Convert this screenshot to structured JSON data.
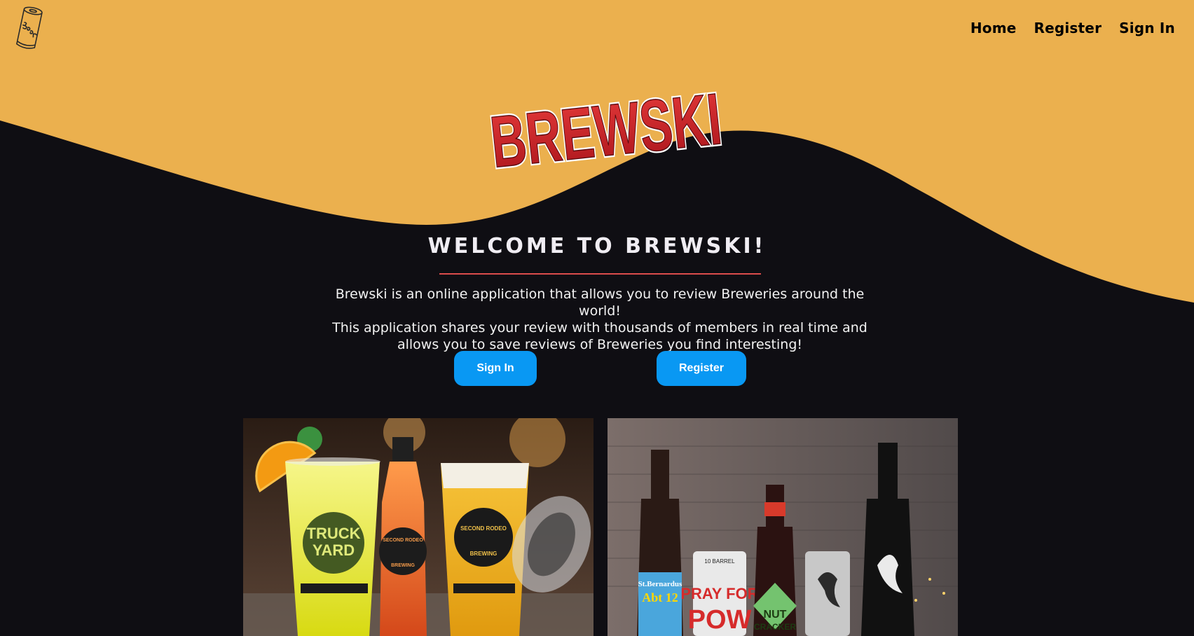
{
  "nav": {
    "logo_icon": "beer-can-icon",
    "links": [
      {
        "label": "Home"
      },
      {
        "label": "Register"
      },
      {
        "label": "Sign In"
      }
    ]
  },
  "hero": {
    "logo_text": "BREWSKI",
    "heading": "WELCOME TO BREWSKI!",
    "intro_lines": [
      "Brewski is an online application that allows you to review Breweries around the world!",
      "This application shares your review with thousands of members in real time and",
      "allows you to save reviews of Breweries you find interesting!"
    ],
    "buttons": {
      "signin": "Sign In",
      "register": "Register"
    }
  },
  "gallery": {
    "left": {
      "truck_yard": [
        "TRUCK",
        "YARD"
      ],
      "rodeo_bottle": [
        "SECOND RODEO",
        "BREWING"
      ],
      "rodeo_cup": [
        "SECOND RODEO",
        "BREWING"
      ]
    },
    "right": {
      "bernardus": [
        "St.Bernardus",
        "Abt 12"
      ],
      "can_brand": "10 BARREL",
      "can_text": [
        "PRAY FOR",
        "POW"
      ],
      "nutcracker": [
        "NUT",
        "CRACKER"
      ]
    }
  },
  "colors": {
    "hero_yellow": "#ebb04e",
    "dark_bg": "#0f0e13",
    "button_blue": "#0998f3",
    "underline_red": "#dc4c4c"
  }
}
